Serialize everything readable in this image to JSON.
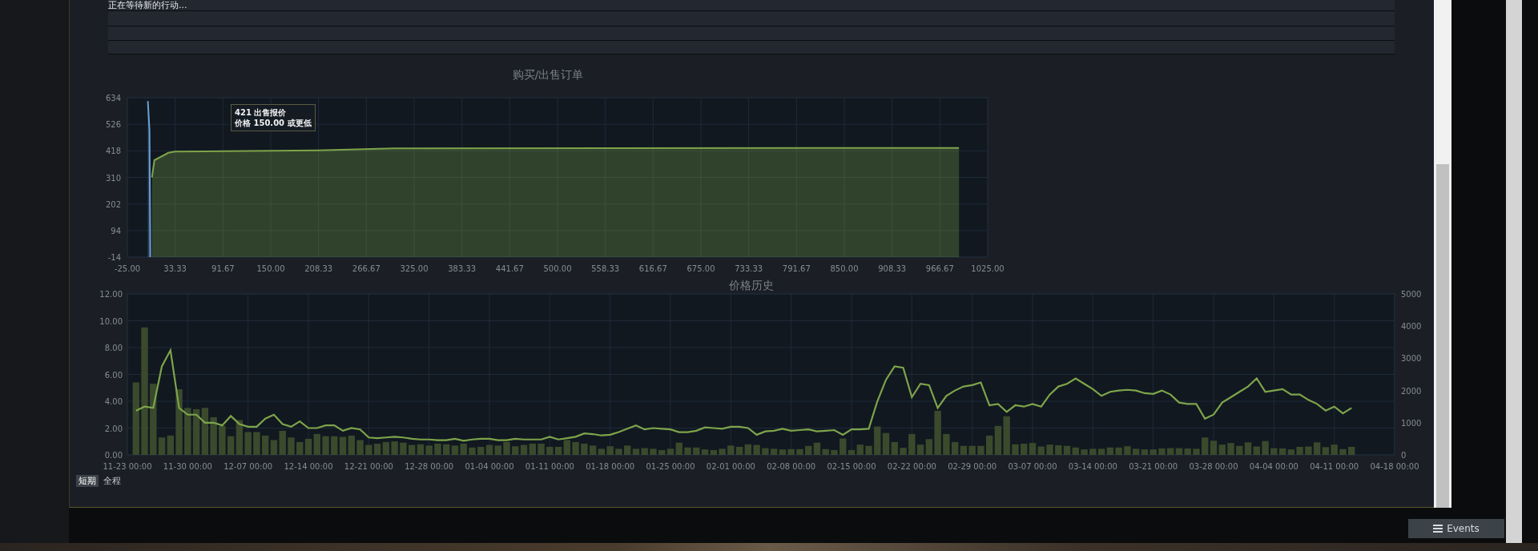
{
  "status_log": {
    "lines": [
      "正在等待新的行动..."
    ]
  },
  "order_chart": {
    "title": "购买/出售订单",
    "tooltip": {
      "lines": [
        "421 出售报价",
        "价格 150.00 或更低"
      ]
    },
    "chart_data": {
      "type": "area",
      "grid": true,
      "x": [
        0,
        2,
        3,
        5,
        8,
        25,
        33,
        208,
        300,
        990
      ],
      "xlim": [
        -25,
        1025
      ],
      "ylim": [
        -14,
        634
      ],
      "xticks": [
        {
          "value": -25,
          "label": "-25.00"
        },
        {
          "value": 33.33,
          "label": "33.33"
        },
        {
          "value": 91.67,
          "label": "91.67"
        },
        {
          "value": 150,
          "label": "150.00"
        },
        {
          "value": 208.33,
          "label": "208.33"
        },
        {
          "value": 266.67,
          "label": "266.67"
        },
        {
          "value": 325,
          "label": "325.00"
        },
        {
          "value": 383.33,
          "label": "383.33"
        },
        {
          "value": 441.67,
          "label": "441.67"
        },
        {
          "value": 500,
          "label": "500.00"
        },
        {
          "value": 558.33,
          "label": "558.33"
        },
        {
          "value": 616.67,
          "label": "616.67"
        },
        {
          "value": 675,
          "label": "675.00"
        },
        {
          "value": 733.33,
          "label": "733.33"
        },
        {
          "value": 791.67,
          "label": "791.67"
        },
        {
          "value": 850,
          "label": "850.00"
        },
        {
          "value": 908.33,
          "label": "908.33"
        },
        {
          "value": 966.67,
          "label": "966.67"
        },
        {
          "value": 1025,
          "label": "1025.00"
        }
      ],
      "yticks": [
        -14,
        94,
        202,
        310,
        418,
        526,
        634
      ],
      "series": [
        {
          "color": "#6b9fd4",
          "values": [
            620,
            500,
            -14,
            null,
            null,
            null,
            null,
            null,
            null,
            null
          ]
        },
        {
          "color": "#7ea44a",
          "values": [
            null,
            null,
            null,
            310,
            380,
            410,
            415,
            420,
            428,
            430
          ]
        }
      ]
    }
  },
  "price_history": {
    "title": "价格历史",
    "chart_data": {
      "type": "line",
      "grid": true,
      "ylim": [
        0,
        12
      ],
      "y2lim": [
        0,
        5000
      ],
      "categories": [
        "11-23 00:00",
        null,
        null,
        null,
        null,
        null,
        null,
        "11-30 00:00",
        null,
        null,
        null,
        null,
        null,
        null,
        "12-07 00:00",
        null,
        null,
        null,
        null,
        null,
        null,
        "12-14 00:00",
        null,
        null,
        null,
        null,
        null,
        null,
        "12-21 00:00",
        null,
        null,
        null,
        null,
        null,
        null,
        "12-28 00:00",
        null,
        null,
        null,
        null,
        null,
        null,
        "01-04 00:00",
        null,
        null,
        null,
        null,
        null,
        null,
        "01-11 00:00",
        null,
        null,
        null,
        null,
        null,
        null,
        "01-18 00:00",
        null,
        null,
        null,
        null,
        null,
        null,
        "01-25 00:00",
        null,
        null,
        null,
        null,
        null,
        null,
        "02-01 00:00",
        null,
        null,
        null,
        null,
        null,
        null,
        "02-08 00:00",
        null,
        null,
        null,
        null,
        null,
        null,
        "02-15 00:00",
        null,
        null,
        null,
        null,
        null,
        null,
        "02-22 00:00",
        null,
        null,
        null,
        null,
        null,
        null,
        "02-29 00:00",
        null,
        null,
        null,
        null,
        null,
        null,
        "03-07 00:00",
        null,
        null,
        null,
        null,
        null,
        null,
        "03-14 00:00",
        null,
        null,
        null,
        null,
        null,
        null,
        "03-21 00:00",
        null,
        null,
        null,
        null,
        null,
        null,
        "03-28 00:00",
        null,
        null,
        null,
        null,
        null,
        null,
        "04-04 00:00",
        null,
        null,
        null,
        null,
        null,
        null,
        "04-11 00:00",
        null,
        null,
        null,
        null,
        null,
        null,
        "04-18 00:00"
      ],
      "yticks": [
        {
          "value": 0,
          "label": "0.00"
        },
        {
          "value": 2,
          "label": "2.00"
        },
        {
          "value": 4,
          "label": "4.00"
        },
        {
          "value": 6,
          "label": "6.00"
        },
        {
          "value": 8,
          "label": "8.00"
        },
        {
          "value": 10,
          "label": "10.00"
        },
        {
          "value": 12,
          "label": "12.00"
        }
      ],
      "y2ticks": [
        0,
        1000,
        2000,
        3000,
        4000,
        5000
      ],
      "series": [
        {
          "type": "bar",
          "axis": "y2",
          "color": "#3a4a2c",
          "values": [
            null,
            2250,
            3960,
            2210,
            540,
            600,
            2040,
            1460,
            1420,
            1460,
            1170,
            900,
            580,
            1080,
            710,
            710,
            600,
            460,
            750,
            540,
            400,
            500,
            650,
            580,
            580,
            560,
            600,
            460,
            310,
            350,
            400,
            420,
            380,
            310,
            330,
            290,
            350,
            330,
            290,
            350,
            230,
            250,
            310,
            290,
            400,
            270,
            310,
            350,
            350,
            250,
            250,
            460,
            400,
            350,
            290,
            190,
            270,
            190,
            290,
            190,
            210,
            190,
            150,
            190,
            380,
            230,
            230,
            170,
            150,
            190,
            290,
            250,
            330,
            310,
            210,
            190,
            170,
            180,
            180,
            280,
            380,
            180,
            150,
            510,
            150,
            320,
            280,
            880,
            680,
            400,
            220,
            650,
            320,
            490,
            1370,
            650,
            400,
            280,
            280,
            280,
            600,
            900,
            1200,
            330,
            350,
            370,
            260,
            320,
            300,
            280,
            230,
            170,
            190,
            190,
            230,
            230,
            270,
            190,
            170,
            170,
            200,
            210,
            210,
            200,
            190,
            540,
            440,
            320,
            370,
            280,
            390,
            260,
            430,
            210,
            200,
            170,
            250,
            260,
            390,
            240,
            320,
            180,
            250,
            null,
            null,
            null,
            null,
            null
          ]
        },
        {
          "type": "line",
          "color": "#7ea44a",
          "values": [
            null,
            3.3,
            3.6,
            3.5,
            6.6,
            7.8,
            3.5,
            3.0,
            3.0,
            2.4,
            2.4,
            2.2,
            2.9,
            2.3,
            2.1,
            2.1,
            2.7,
            3.0,
            2.3,
            2.1,
            2.5,
            2.0,
            2.0,
            2.2,
            2.2,
            1.8,
            2.0,
            1.9,
            1.3,
            1.25,
            1.3,
            1.35,
            1.3,
            1.2,
            1.15,
            1.15,
            1.1,
            1.1,
            1.2,
            1.05,
            1.15,
            1.2,
            1.2,
            1.1,
            1.1,
            1.2,
            1.15,
            1.15,
            1.15,
            1.35,
            1.15,
            1.25,
            1.35,
            1.6,
            1.55,
            1.45,
            1.5,
            1.7,
            1.95,
            2.2,
            1.9,
            2.0,
            1.95,
            1.9,
            1.7,
            1.7,
            1.8,
            2.05,
            2.0,
            1.95,
            2.1,
            2.1,
            2.0,
            1.5,
            1.75,
            1.8,
            1.95,
            1.8,
            1.85,
            1.9,
            1.75,
            1.8,
            1.85,
            1.5,
            1.9,
            1.9,
            1.95,
            4.0,
            5.6,
            6.6,
            6.5,
            4.3,
            5.3,
            5.2,
            3.5,
            4.4,
            4.8,
            5.1,
            5.2,
            5.4,
            3.7,
            3.8,
            3.2,
            3.7,
            3.6,
            3.8,
            3.6,
            4.5,
            5.1,
            5.3,
            5.7,
            5.3,
            4.9,
            4.4,
            4.7,
            4.8,
            4.85,
            4.8,
            4.6,
            4.55,
            4.8,
            4.5,
            3.9,
            3.8,
            3.8,
            2.7,
            3.0,
            3.9,
            4.3,
            4.7,
            5.1,
            5.7,
            4.7,
            4.8,
            4.9,
            4.5,
            4.5,
            4.1,
            3.8,
            3.3,
            3.6,
            3.1,
            3.5,
            null,
            null,
            null,
            null,
            null
          ]
        }
      ]
    },
    "range_buttons": [
      {
        "label": "短期",
        "selected": true
      },
      {
        "label": "全程",
        "selected": false
      }
    ]
  },
  "events_button": {
    "label": "Events"
  }
}
